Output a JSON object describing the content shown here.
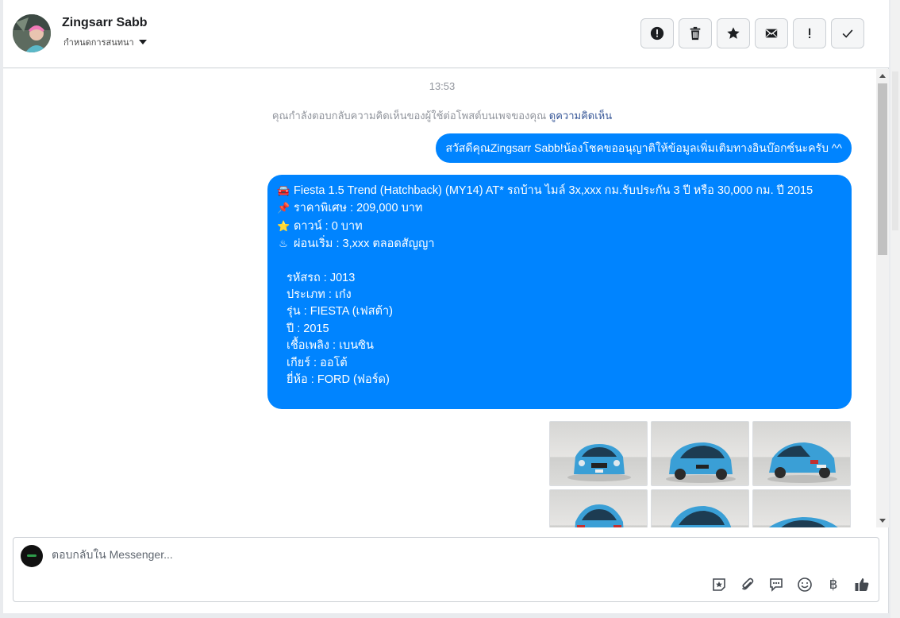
{
  "header": {
    "contact_name": "Zingsarr Sabb",
    "assign_label": "กำหนดการสนทนา",
    "toolbar": [
      "alert-icon",
      "trash-icon",
      "star-icon",
      "envelope-icon",
      "exclamation-icon",
      "check-icon"
    ]
  },
  "conversation": {
    "timestamp": "13:53",
    "context_text": "คุณกำลังตอบกลับความคิดเห็นของผู้ใช้ต่อโพสต์บนเพจของคุณ",
    "context_link": "ดูความคิดเห็น",
    "message1": "สวัสดีคุณZingsarr Sabb!น้องโชคขออนุญาติให้ข้อมูลเพิ่มเติมทางอินบ๊อกซ์นะครับ ^^",
    "message2": {
      "title_line": "Fiesta 1.5 Trend (Hatchback) (MY14) AT* รถบ้าน ไมล์ 3x,xxx กม.รับประกัน 3 ปี หรือ 30,000 กม. ปี 2015",
      "price_line": "ราคาพิเศษ : 209,000 บาท",
      "down_line": "ดาวน์ : 0 บาท",
      "installment_line": "ผ่อนเริ่ม : 3,xxx ตลอดสัญญา",
      "details": [
        "รหัสรถ : J013",
        "ประเภท : เก๋ง",
        "รุ่น : FIESTA (เฟสต้า)",
        "ปี : 2015",
        "เชื้อเพลิง : เบนซิน",
        "เกียร์ : ออโต้",
        "ยี่ห้อ : FORD (ฟอร์ด)"
      ]
    },
    "photos": [
      "car-front",
      "car-front-angle",
      "car-rear-angle",
      "car-rear",
      "car-front-angle",
      "car-side"
    ]
  },
  "composer": {
    "placeholder": "ตอบกลับใน Messenger...",
    "icons": [
      "sticker-icon",
      "attachment-icon",
      "saved-reply-icon",
      "emoji-icon",
      "baht-icon",
      "like-icon"
    ]
  },
  "colors": {
    "bubble": "#0084ff",
    "link": "#385898",
    "car_body": "#3a9fd6"
  }
}
